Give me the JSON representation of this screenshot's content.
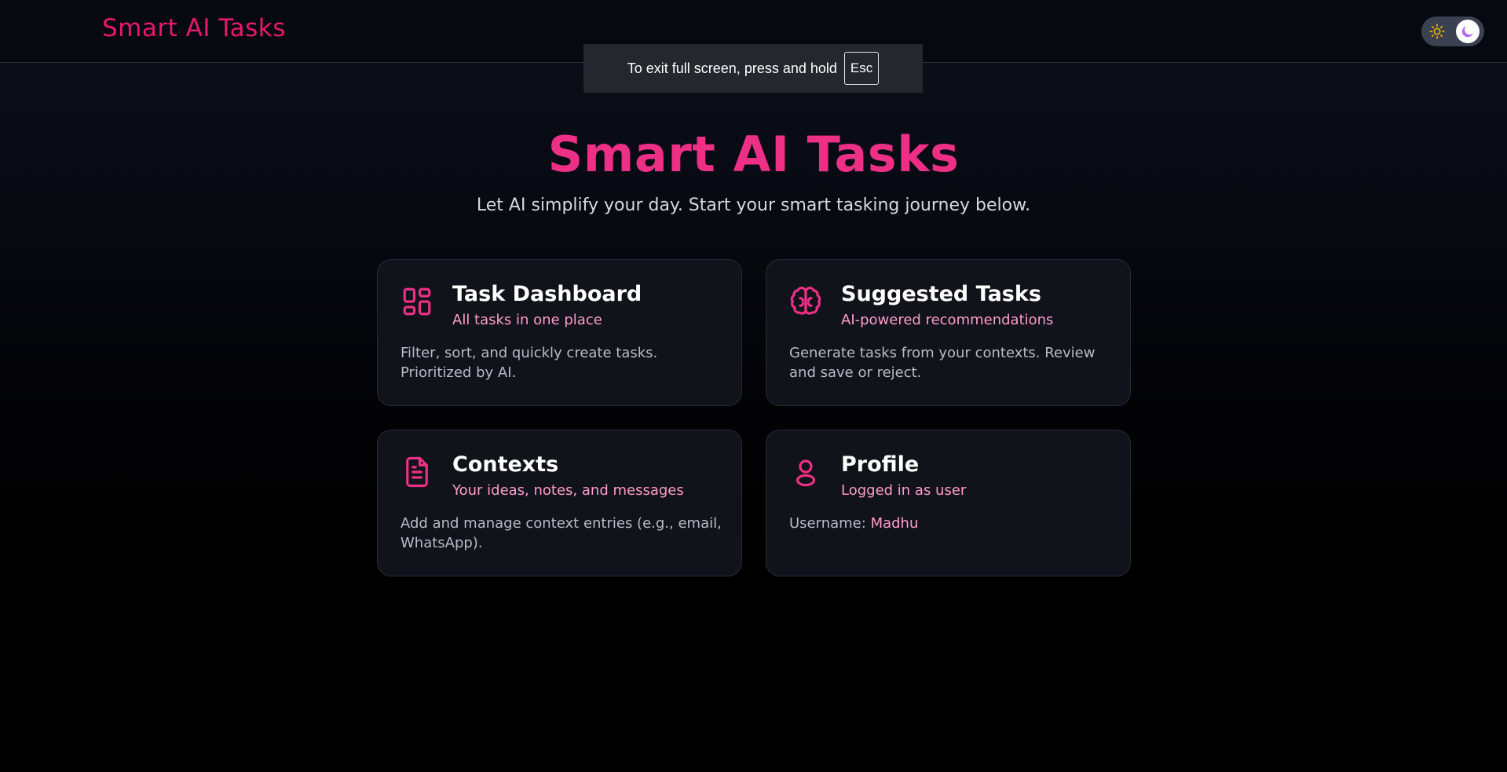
{
  "header": {
    "brand": "Smart AI Tasks",
    "theme_toggle": {
      "state": "dark",
      "icons": [
        "sun-icon",
        "moon-icon"
      ]
    }
  },
  "fullscreen_notice": {
    "text": "To exit full screen, press and hold",
    "key": "Esc"
  },
  "hero": {
    "title": "Smart AI Tasks",
    "subtitle": "Let AI simplify your day. Start your smart tasking journey below."
  },
  "cards": [
    {
      "icon": "dashboard-icon",
      "title": "Task Dashboard",
      "subtitle": "All tasks in one place",
      "description": "Filter, sort, and quickly create tasks. Prioritized by AI."
    },
    {
      "icon": "brain-icon",
      "title": "Suggested Tasks",
      "subtitle": "AI-powered recommendations",
      "description": "Generate tasks from your contexts. Review and save or reject."
    },
    {
      "icon": "document-icon",
      "title": "Contexts",
      "subtitle": "Your ideas, notes, and messages",
      "description": "Add and manage context entries (e.g., email, WhatsApp)."
    },
    {
      "icon": "user-icon",
      "title": "Profile",
      "subtitle": "Logged in as user",
      "username_label": "Username:",
      "username": "Madhu"
    }
  ],
  "colors": {
    "accent": "#ed2f86",
    "brand": "#e8186f",
    "accent_light": "#ff9cc9",
    "card_background": "#11131a",
    "text_muted": "#b9bcc4"
  }
}
